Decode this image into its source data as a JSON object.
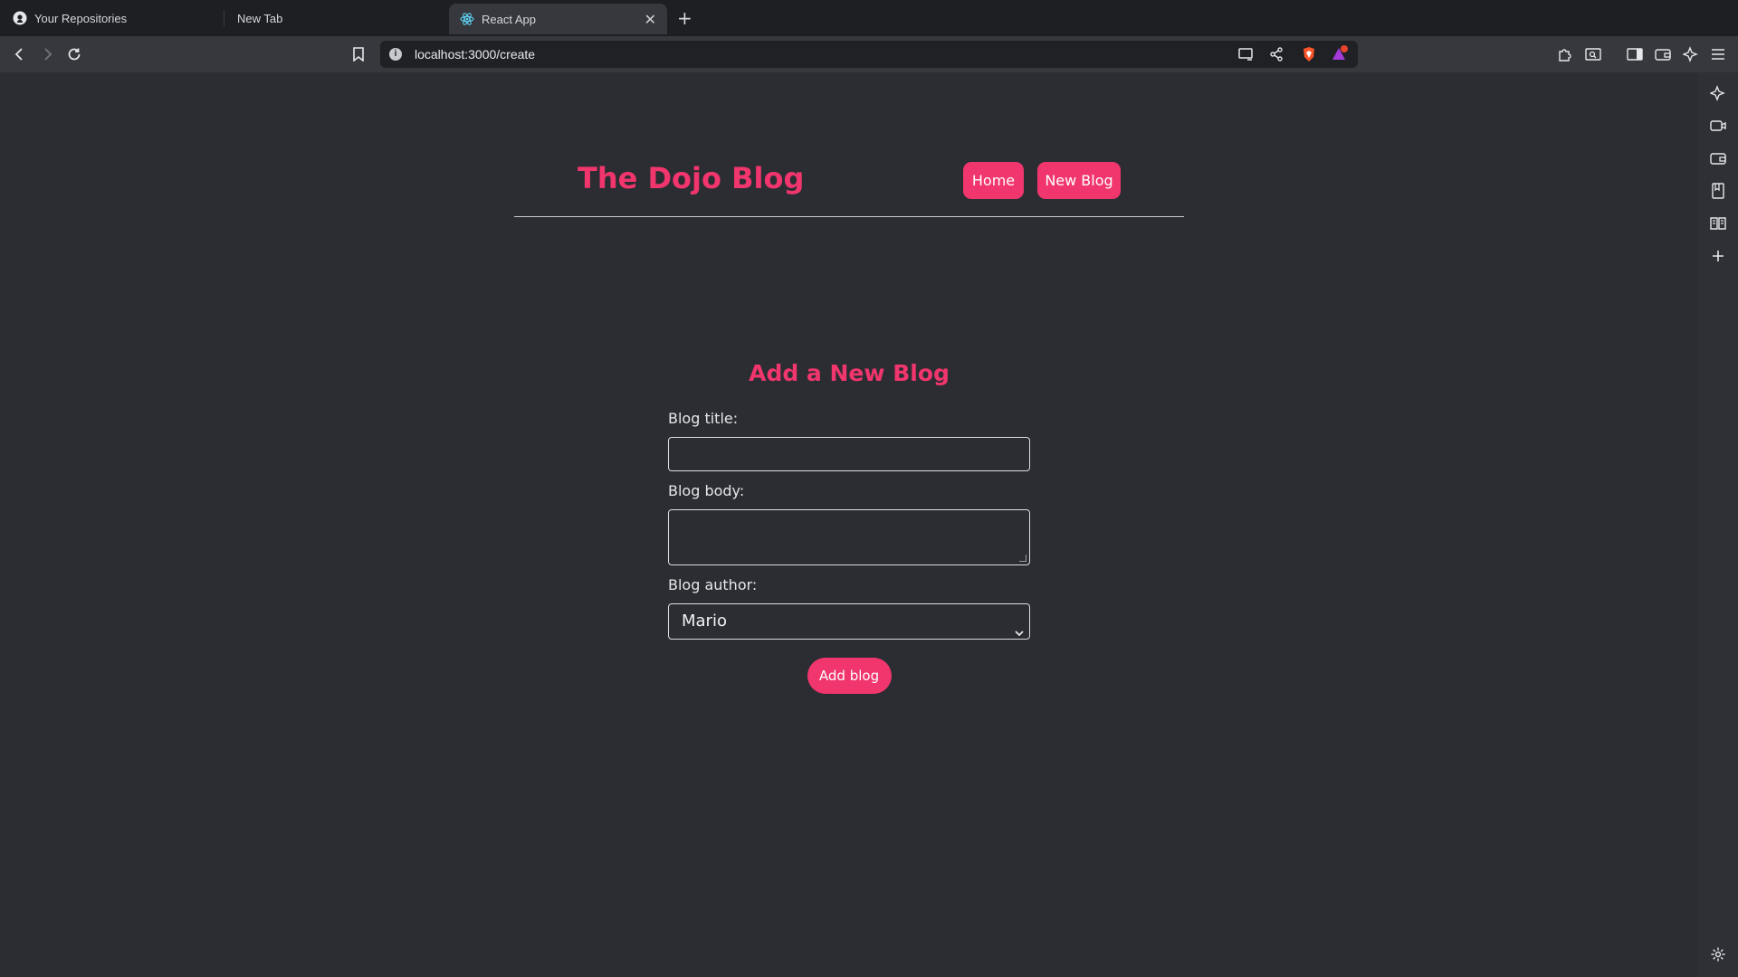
{
  "browser": {
    "tabs": [
      {
        "label": "Your Repositories",
        "icon": "github-icon"
      },
      {
        "label": "New Tab"
      },
      {
        "label": "React App",
        "icon": "react-icon",
        "active": true
      }
    ],
    "url": "localhost:3000/create"
  },
  "site": {
    "brand": "The Dojo Blog",
    "nav": {
      "home": "Home",
      "new_blog": "New Blog"
    }
  },
  "create": {
    "heading": "Add a New Blog",
    "title_label": "Blog title:",
    "title_value": "",
    "body_label": "Blog body:",
    "body_value": "",
    "author_label": "Blog author:",
    "author_selected": "Mario",
    "submit_label": "Add blog"
  },
  "colors": {
    "accent": "#f1356d",
    "background": "#2b2d33"
  }
}
